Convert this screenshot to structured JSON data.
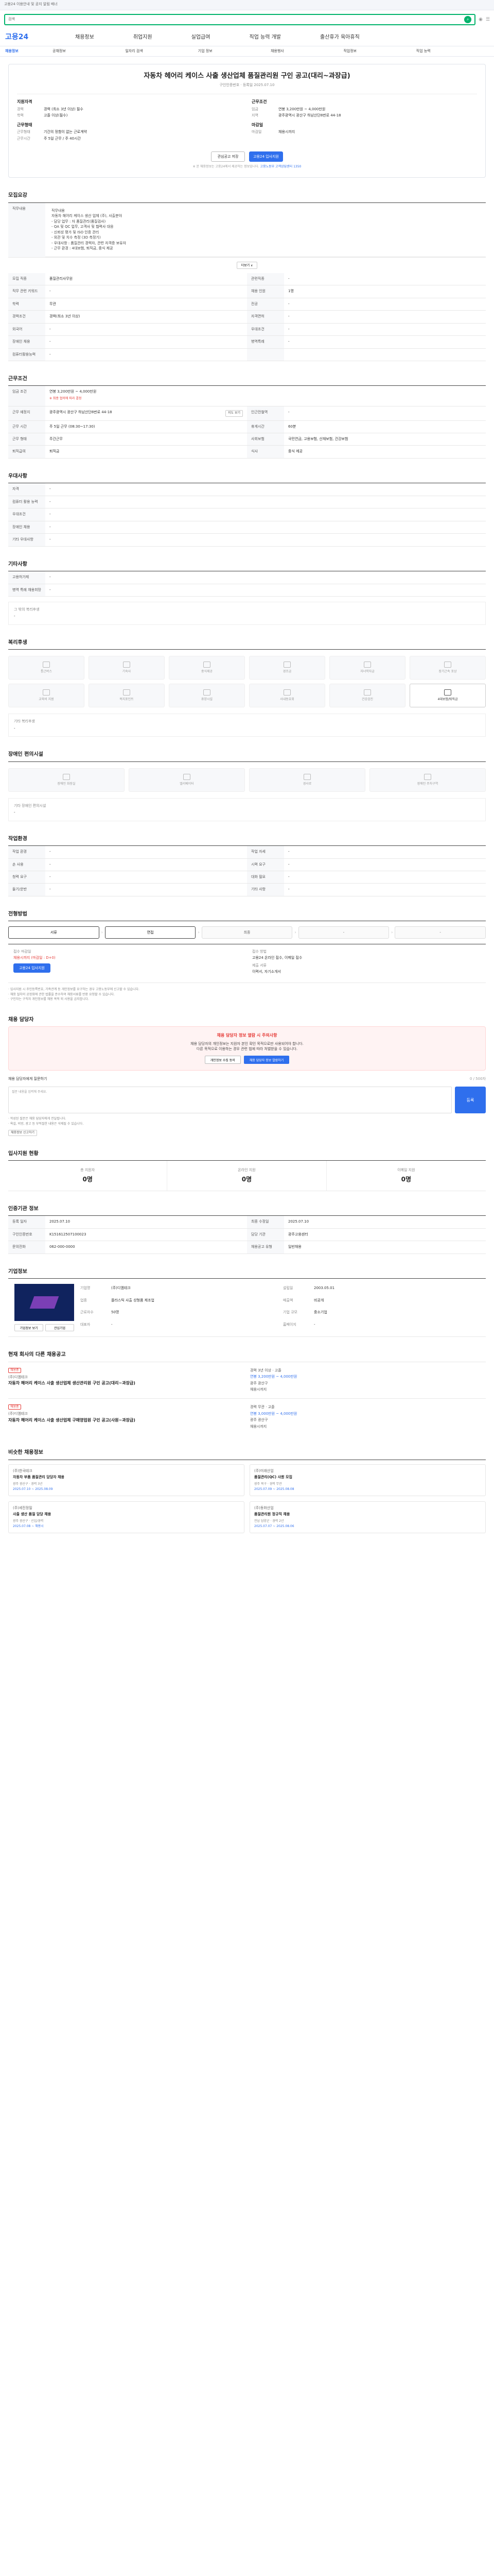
{
  "top_banner": "고용24 이용안내 및 공지 알림 배너",
  "search": {
    "placeholder": "검색",
    "icon": "search-icon"
  },
  "gnb": {
    "logo": "고용24",
    "items": [
      "채용정보",
      "취업지원",
      "실업급여",
      "직업 능력 개발",
      "출산휴가 육아휴직"
    ]
  },
  "lnb": {
    "items": [
      "채용정보",
      "공채정보",
      "일자리 검색",
      "기업 정보",
      "채용행사",
      "직업정보",
      "직업 능력"
    ]
  },
  "job": {
    "title": "자동차 헤어리 케이스 사출 생산업체 품질관리원 구인 공고(대리~과장급)",
    "subtitle": "구인인증번호 · 등록일 2025.07.10",
    "left": {
      "heading": "지원자격",
      "rows": [
        {
          "k": "경력",
          "v": "경력 (최소 3년 이상) 필수"
        },
        {
          "k": "학력",
          "v": "고졸 이상(필수)"
        }
      ],
      "heading2": "근무형태",
      "rows2": [
        {
          "k": "근무형태",
          "v": "기간의 정함이 없는 근로계약"
        },
        {
          "k": "근무시간",
          "v": "주 5일 근무 / 주 40시간"
        }
      ]
    },
    "right": {
      "heading": "근무조건",
      "rows": [
        {
          "k": "임금",
          "v": "연봉 3,200만원 ~ 4,000만원"
        },
        {
          "k": "지역",
          "v": "광주광역시 광산구 하남산단8번로 44-18"
        }
      ],
      "heading2": "마감일",
      "rows2": [
        {
          "k": "마감일",
          "v": "채용시까지"
        }
      ]
    },
    "btn_scrap": "관심공고 저장",
    "btn_apply": "고용24 입사지원",
    "notice_a": "※ 본 채용정보는 고용24에서 제공하는 정보입니다. ",
    "notice_b": "고용노동부 고객상담센터 1350"
  },
  "recruit": {
    "title": "모집요강",
    "desc_label": "직무내용",
    "desc": "직무내용\n자동차 헤어리 케이스 생산 업체 (주), 사출분야\n- 담당 업무 : 자 품질관리(품질검사)\n  - QA 및 QC 업무, 고객사 및 협력사 대응\n  - 신뢰성 평가 및 ISO 인증 관리\n  - 외관 및 치수 측정 (3D 측정기)\n- 우대사항 : 품질관리 경력자, 관련 자격증 보유자\n- 근무 환경 : 4대보험, 퇴직금, 중식 제공",
    "more": "더보기 ∨",
    "rows": [
      [
        "모집 직종",
        "품질관리사무원",
        "관련직종",
        "-"
      ],
      [
        "직무 관련 키워드",
        "-",
        "채용 인원",
        "1명"
      ],
      [
        "학력",
        "무관",
        "전공",
        "-"
      ],
      [
        "경력조건",
        "경력(최소 3년 이상)",
        "자격면허",
        "-"
      ],
      [
        "외국어",
        "-",
        "우대조건",
        "-"
      ],
      [
        "장애인 채용",
        "-",
        "병역특례",
        "-"
      ],
      [
        "컴퓨터활용능력",
        "-",
        "",
        ""
      ]
    ]
  },
  "conditions": {
    "title": "근무조건",
    "wage_label": "임금 조건",
    "wage_value": "연봉 3,200만원 ~ 4,000만원",
    "wage_note": "※ 최종 협의에 따라 결정",
    "rows": [
      [
        "근무 예정지",
        "광주광역시 광산구 하남산단8번로 44-18",
        "인근전철역",
        "-"
      ],
      [
        "근무 시간",
        "주 5일 근무 (08:30~17:30)",
        "휴게시간",
        "60분"
      ],
      [
        "근무 형태",
        "주간근무",
        "사회보험",
        "국민연금, 고용보험, 산재보험, 건강보험"
      ],
      [
        "퇴직급여",
        "퇴직금",
        "식사",
        "중식 제공"
      ]
    ],
    "map_btn": "지도 보기"
  },
  "extra": {
    "title": "우대사항",
    "rows": [
      [
        "자격",
        "-"
      ],
      [
        "컴퓨터 활용 능력",
        "-"
      ],
      [
        "우대조건",
        "-"
      ],
      [
        "장애인 채용",
        "-"
      ],
      [
        "기타 우대사항",
        "-"
      ]
    ]
  },
  "misc": {
    "title": "기타사항",
    "rows": [
      [
        "고용허가제",
        "-"
      ],
      [
        "병역 특례 채용희망",
        "-"
      ]
    ],
    "note_label": "그 밖의 복리후생",
    "note_value": "-"
  },
  "benefits": {
    "title": "복리후생",
    "items": [
      "통근버스",
      "기숙사",
      "중식제공",
      "경조금",
      "자녀학자금",
      "장기근속 포상",
      "교육비 지원",
      "복지포인트",
      "휴양시설",
      "사내동호회",
      "건강검진",
      "4대보험/퇴직금"
    ],
    "on_index": 11,
    "note_label": "기타 복리후생",
    "note_value": "-"
  },
  "disability": {
    "title": "장애인 편의시설",
    "items": [
      "장애인 화장실",
      "엘리베이터",
      "경사로",
      "장애인 주차구역"
    ],
    "note_label": "기타 장애인 편의시설",
    "note_value": "-"
  },
  "workplace": {
    "title": "작업환경",
    "rows": [
      [
        "작업 환경",
        "-",
        "작업 자세",
        "-"
      ],
      [
        "손 사용",
        "-",
        "시력 요구",
        "-"
      ],
      [
        "청력 요구",
        "-",
        "대화 필요",
        "-"
      ],
      [
        "들기/운반",
        "-",
        "기타 사항",
        "-"
      ]
    ]
  },
  "process": {
    "title": "전형방법",
    "steps": [
      "서류",
      "면접",
      "최종",
      "-",
      "-"
    ]
  },
  "apply": {
    "deadline_label": "접수 마감일",
    "deadline_value": "채용시까지 (마감일 : D+0)",
    "method_label": "접수 방법",
    "method_value": "고용24 온라인 접수, 이메일 접수",
    "doc_label": "제출 서류",
    "doc_value": "이력서, 자기소개서",
    "btn": "고용24 입사지원",
    "notes": [
      "· 입사지원 시 주민등록번호, 가족관계 등 개인정보를 요구하는 경우 고용노동부에 신고할 수 있습니다.",
      "· 채용 절차의 공정화에 관한 법률을 준수하여 채용서류를 반환 요청할 수 있습니다.",
      "· 구인자는 구직자 개인정보를 채용 목적 외 사용을 금지합니다."
    ]
  },
  "qna": {
    "title": "채용 담당자",
    "pink_title": "채용 담당자 정보 열람 시 주의사항",
    "pink_text": "채용 담당자의 개인정보는 지원자 본인 확인 목적으로만 사용되어야 합니다.",
    "pink_text2": "다른 목적으로 이용하는 경우 관련 법에 따라 처벌받을 수 있습니다.",
    "tab1": "개인정보 수집 동의",
    "tab2": "채용 담당자 정보 열람하기",
    "form_label": "채용 담당자에게 질문하기",
    "form_count": "0 / 500자",
    "placeholder": "질문 내용을 입력해 주세요.",
    "btn": "등록",
    "notes": [
      "· 작성된 질문은 채용 담당자에게 전달됩니다.",
      "· 욕설, 비방, 광고 등 부적절한 내용은 삭제될 수 있습니다."
    ],
    "report": "채용정보 신고하기"
  },
  "stats": {
    "title": "입사지원 현황",
    "items": [
      {
        "label": "총 지원자",
        "value": "0명"
      },
      {
        "label": "온라인 지원",
        "value": "0명"
      },
      {
        "label": "이메일 지원",
        "value": "0명"
      }
    ]
  },
  "admin": {
    "title": "인증기관 정보",
    "rows": [
      [
        "등록 일자",
        "2025.07.10",
        "최종 수정일",
        "2025.07.10"
      ],
      [
        "구인인증번호",
        "K151612507100023",
        "담당 기관",
        "광주고용센터"
      ],
      [
        "문의전화",
        "062-000-0000",
        "채용공고 유형",
        "일반채용"
      ]
    ]
  },
  "company": {
    "title": "기업정보",
    "btn1": "기업정보 보기",
    "btn2": "관심기업",
    "rows": [
      [
        "기업명",
        "(주)디엠테크",
        "설립일",
        "2003.05.01"
      ],
      [
        "업종",
        "플라스틱 사출 성형품 제조업",
        "매출액",
        "비공개"
      ],
      [
        "근로자수",
        "50명",
        "기업 규모",
        "중소기업"
      ],
      [
        "대표자",
        "-",
        "홈페이지",
        "-"
      ]
    ]
  },
  "related_jobs": {
    "title": "현재 회사의 다른 채용공고",
    "items": [
      {
        "badge": "채용중",
        "co": "(주)디엠테크",
        "title": "자동차 헤어리 케이스 사출 생산업체 생산관리원 구인 공고(대리~과장급)",
        "meta1": "경력 3년 이상 · 고졸",
        "meta2": "연봉 3,200만원 ~ 4,000만원",
        "meta3": "광주 광산구",
        "deadline": "채용시까지"
      },
      {
        "badge": "채용중",
        "co": "(주)디엠테크",
        "title": "자동차 헤어리 케이스 사출 생산업체 구매영업원 구인 공고(사원~과장급)",
        "meta1": "경력 무관 · 고졸",
        "meta2": "연봉 3,000만원 ~ 4,000만원",
        "meta3": "광주 광산구",
        "deadline": "채용시까지"
      }
    ]
  },
  "recommend": {
    "title": "비슷한 채용정보",
    "items": [
      {
        "co": "(주)한국테크",
        "title": "자동차 부품 품질관리 담당자 채용",
        "meta": "광주 광산구 · 경력 3년",
        "date": "2025.07.10 ~ 2025.08.09"
      },
      {
        "co": "(주)미래산업",
        "title": "품질관리(QC) 사원 모집",
        "meta": "광주 북구 · 경력 무관",
        "date": "2025.07.09 ~ 2025.08.08"
      },
      {
        "co": "(주)세진정밀",
        "title": "사출 생산 품질 담당 채용",
        "meta": "광주 광산구 · 신입/경력",
        "date": "2025.07.08 ~ 채용시"
      },
      {
        "co": "(주)동화산업",
        "title": "품질관리원 정규직 채용",
        "meta": "전남 담양군 · 경력 2년",
        "date": "2025.07.07 ~ 2025.08.06"
      }
    ]
  }
}
